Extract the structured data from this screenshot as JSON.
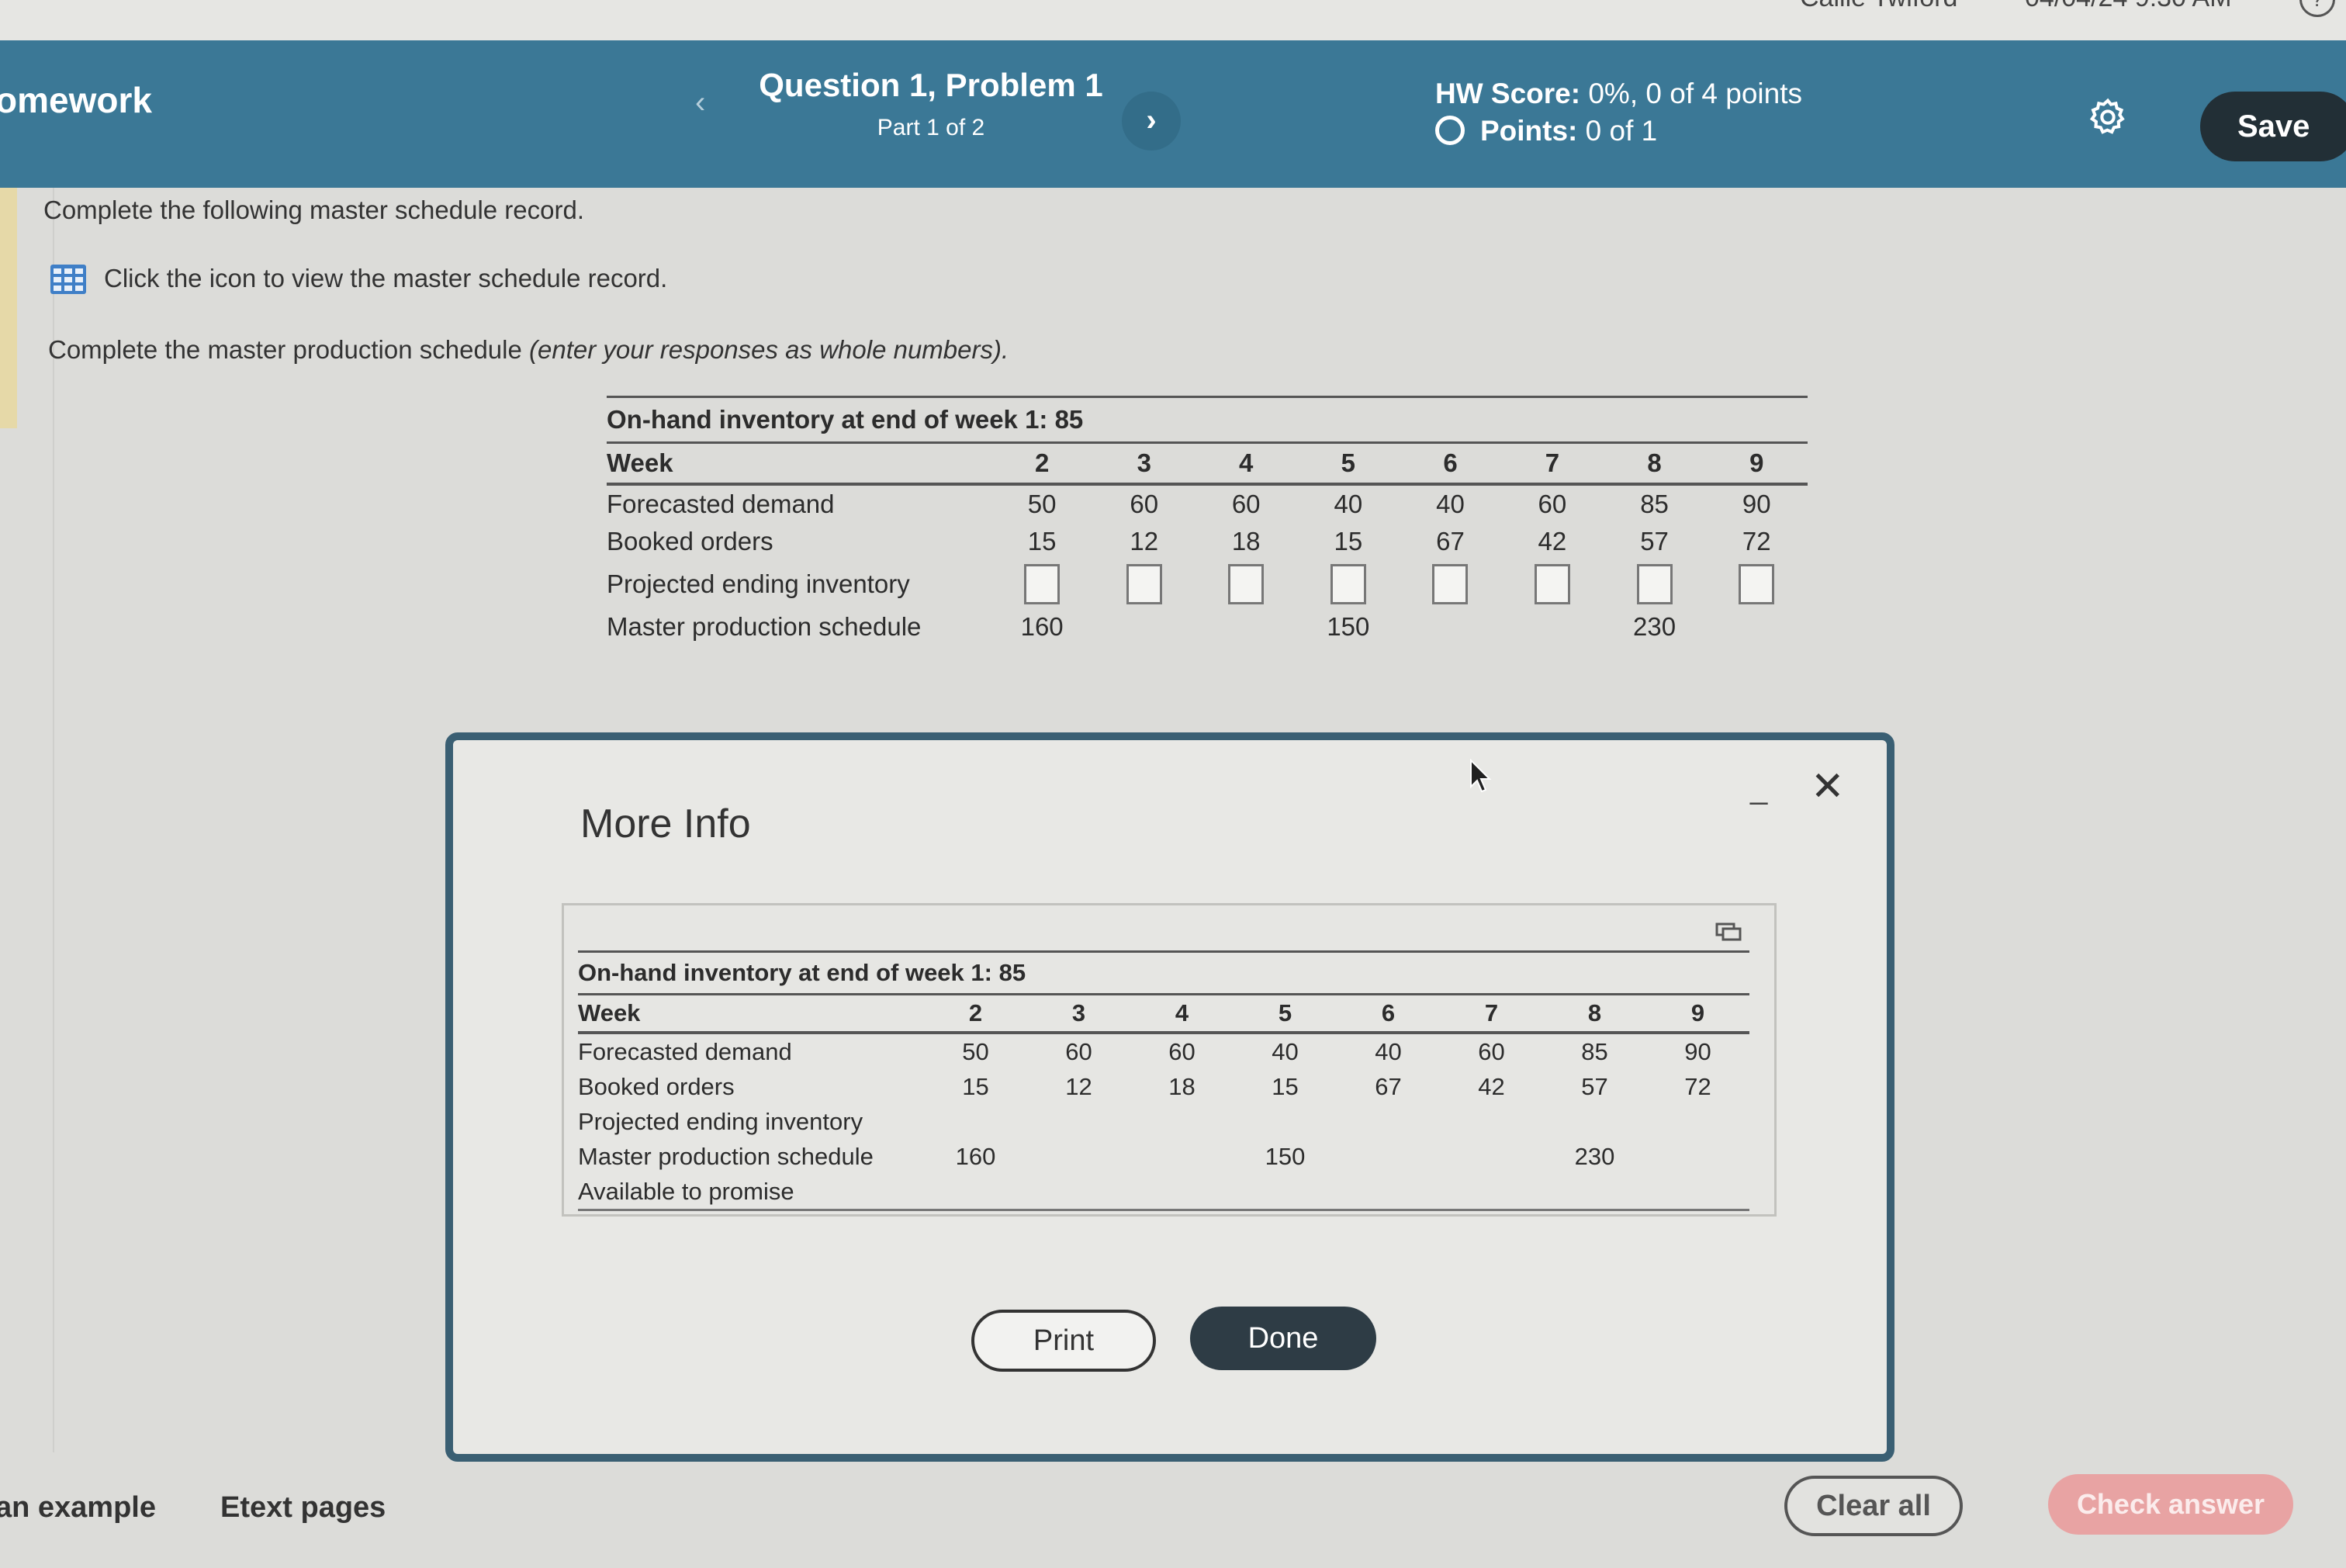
{
  "top": {
    "user": "Callie Twiford",
    "datetime": "04/04/24 9:30 AM",
    "help_icon": "?"
  },
  "header": {
    "app_title": "omework",
    "question_title": "Question 1, Problem 1",
    "question_sub": "Part 1 of 2",
    "prev_icon": "‹",
    "next_icon": "›",
    "hw_score_label": "HW Score:",
    "hw_score_value": "0%, 0 of 4 points",
    "points_label": "Points:",
    "points_value": "0 of 1",
    "save_label": "Save"
  },
  "instructions": {
    "line1": "Complete the following master schedule record.",
    "line2": "Click the icon to view the master schedule record.",
    "line3_a": "Complete the master production schedule ",
    "line3_b": "(enter your responses as whole numbers)."
  },
  "main_table": {
    "caption": "On-hand inventory at end of week 1: 85",
    "week_label": "Week",
    "weeks": [
      "2",
      "3",
      "4",
      "5",
      "6",
      "7",
      "8",
      "9"
    ],
    "forecast_label": "Forecasted demand",
    "forecast": [
      "50",
      "60",
      "60",
      "40",
      "40",
      "60",
      "85",
      "90"
    ],
    "booked_label": "Booked orders",
    "booked": [
      "15",
      "12",
      "18",
      "15",
      "67",
      "42",
      "57",
      "72"
    ],
    "pei_label": "Projected ending inventory",
    "pei": [
      "",
      "",
      "",
      "",
      "",
      "",
      "",
      ""
    ],
    "mps_label": "Master production schedule",
    "mps": [
      "160",
      "",
      "",
      "150",
      "",
      "",
      "230",
      ""
    ]
  },
  "dialog": {
    "title": "More Info",
    "minimize": "_",
    "close": "✕",
    "table": {
      "caption": "On-hand inventory at end of week 1: 85",
      "week_label": "Week",
      "weeks": [
        "2",
        "3",
        "4",
        "5",
        "6",
        "7",
        "8",
        "9"
      ],
      "forecast_label": "Forecasted demand",
      "forecast": [
        "50",
        "60",
        "60",
        "40",
        "40",
        "60",
        "85",
        "90"
      ],
      "booked_label": "Booked orders",
      "booked": [
        "15",
        "12",
        "18",
        "15",
        "67",
        "42",
        "57",
        "72"
      ],
      "pei_label": "Projected ending inventory",
      "mps_label": "Master production schedule",
      "mps": [
        "160",
        "",
        "",
        "150",
        "",
        "",
        "230",
        ""
      ],
      "atp_label": "Available to promise"
    },
    "print_label": "Print",
    "done_label": "Done"
  },
  "footer": {
    "example_label": "an example",
    "etext_label": "Etext pages",
    "clear_label": "Clear all",
    "check_label": "Check answer"
  },
  "colors": {
    "header_bg": "#3b7896",
    "save_bg": "#222f36",
    "check_bg": "#e8a3a3",
    "dialog_border": "#3a5f73"
  }
}
